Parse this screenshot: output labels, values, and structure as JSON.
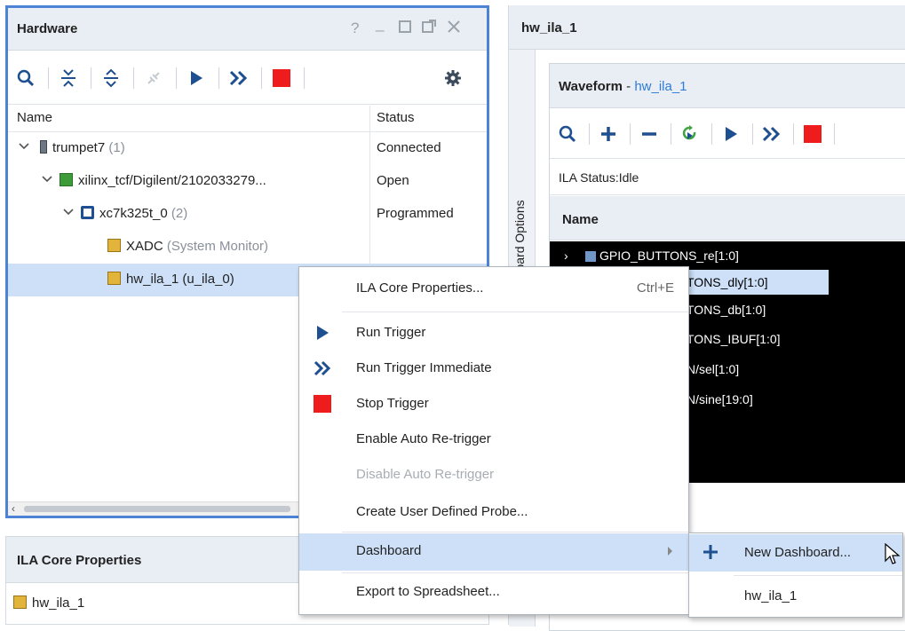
{
  "hardware": {
    "title": "Hardware",
    "ctl_help": "?",
    "ctl_min": "_",
    "col_name": "Name",
    "col_status": "Status",
    "rows": [
      {
        "label": "trumpet7",
        "count": "(1)",
        "status": "Connected"
      },
      {
        "label": "xilinx_tcf/Digilent/2102033279...",
        "status": "Open"
      },
      {
        "label": "xc7k325t_0",
        "count": "(2)",
        "status": "Programmed"
      },
      {
        "label": "XADC",
        "suffix": "(System Monitor)",
        "status": ""
      },
      {
        "label": "hw_ila_1 (u_ila_0)",
        "status": ""
      }
    ]
  },
  "ila_props": {
    "title": "ILA Core Properties",
    "item": "hw_ila_1"
  },
  "right": {
    "title": "hw_ila_1",
    "vtab": "Dashboard Options",
    "waveform_title": "Waveform",
    "waveform_dash": " - ",
    "waveform_target": "hw_ila_1",
    "ila_status": "ILA Status:Idle",
    "col_name": "Name",
    "signals": [
      "GPIO_BUTTONS_re[1:0]",
      "TONS_dly[1:0]",
      "TONS_db[1:0]",
      "TONS_IBUF[1:0]",
      "N/sel[1:0]",
      "N/sine[19:0]"
    ]
  },
  "context_menu": {
    "items": [
      {
        "label": "ILA Core Properties...",
        "shortcut": "Ctrl+E"
      },
      {
        "label": "Run Trigger"
      },
      {
        "label": "Run Trigger Immediate"
      },
      {
        "label": "Stop Trigger"
      },
      {
        "label": "Enable Auto Re-trigger"
      },
      {
        "label": "Disable Auto Re-trigger"
      },
      {
        "label": "Create User Defined Probe..."
      },
      {
        "label": "Dashboard"
      },
      {
        "label": "Export to Spreadsheet..."
      }
    ]
  },
  "submenu": {
    "items": [
      {
        "label": "New Dashboard..."
      },
      {
        "label": "hw_ila_1"
      }
    ]
  },
  "colors": {
    "accent": "#4c83d4",
    "highlight": "#cde0f8",
    "stop_red": "#ee1c1c",
    "link_blue": "#2f7bd6",
    "run_blue": "#1d4f91"
  }
}
